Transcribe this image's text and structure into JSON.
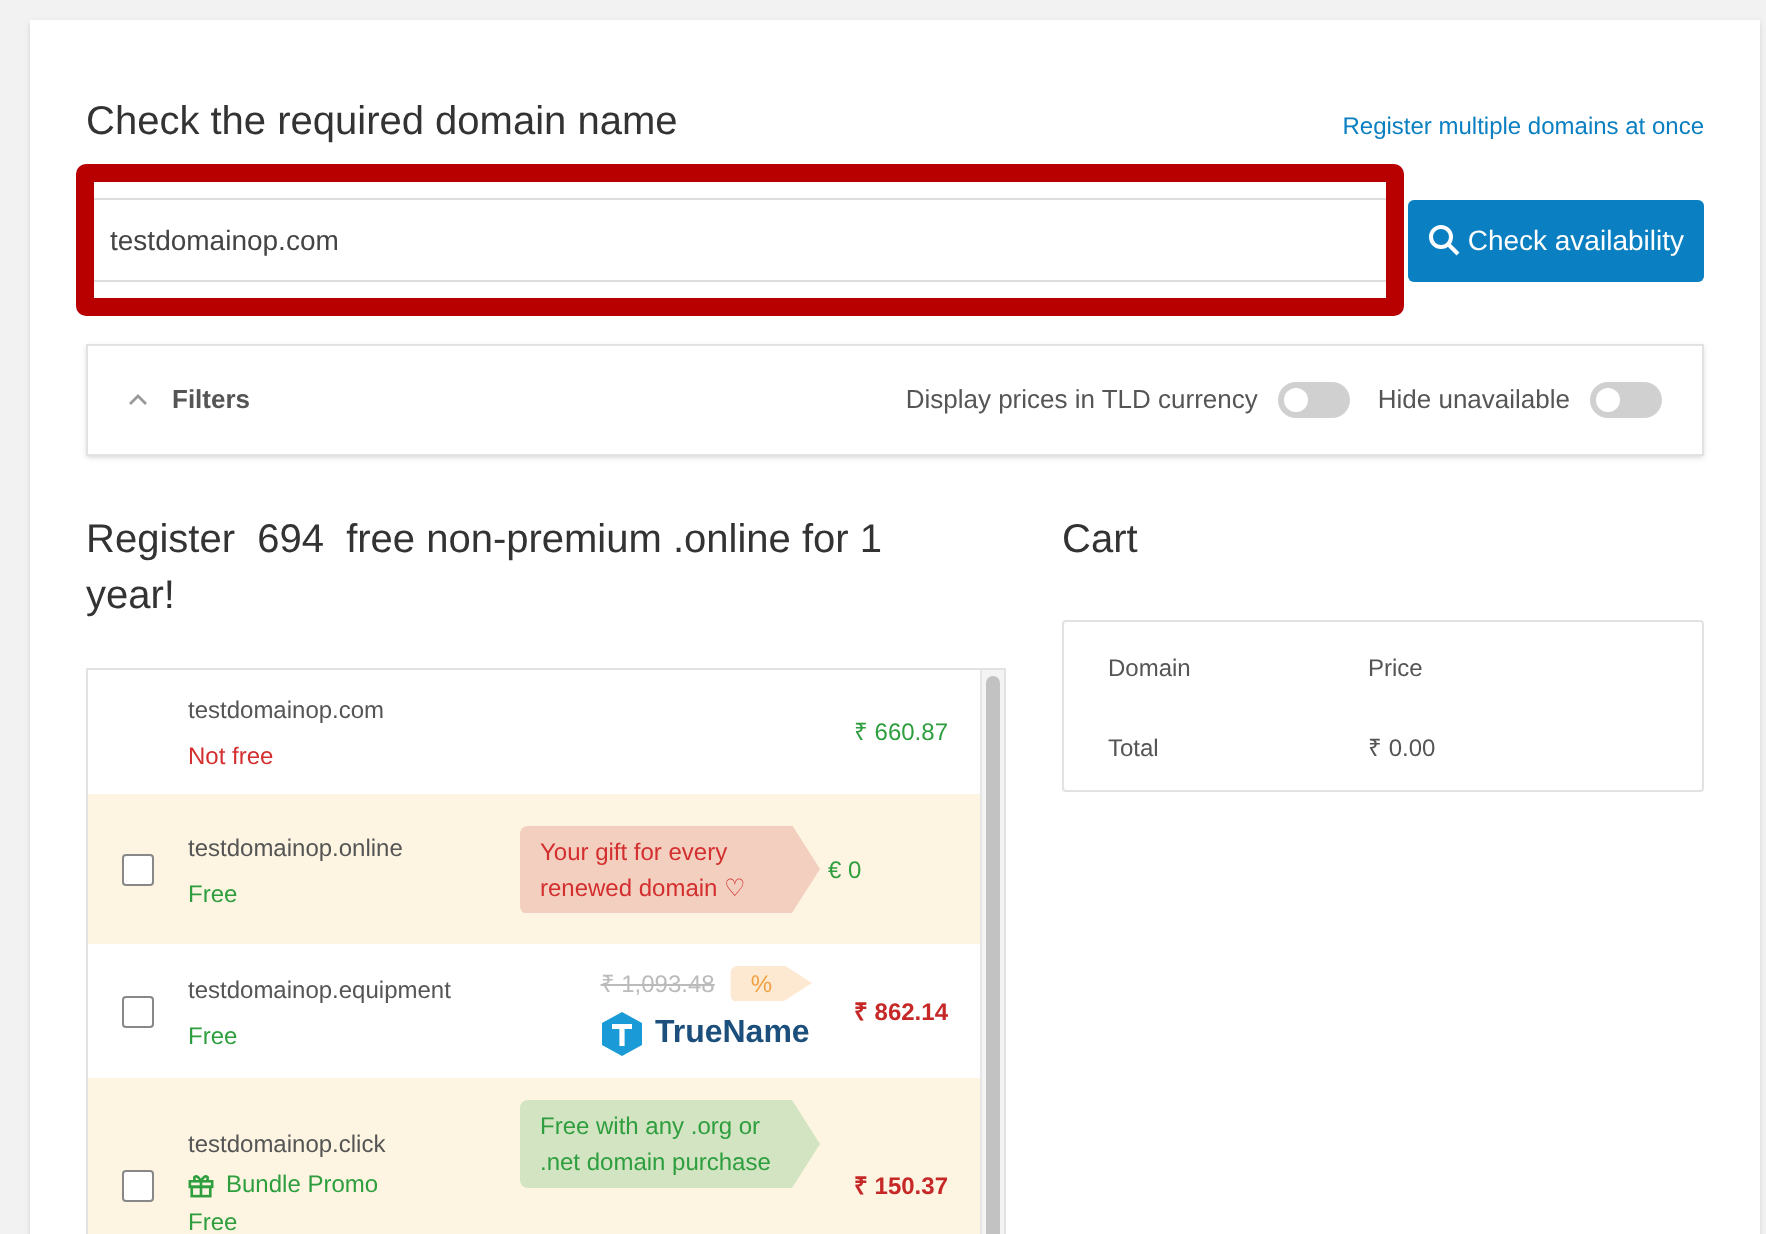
{
  "search": {
    "title": "Check the required domain name",
    "bulk_link": "Register multiple domains at once",
    "value": "testdomainop.com",
    "button": "Check availability",
    "highlighted": true
  },
  "filters": {
    "label": "Filters",
    "expanded": true,
    "toggles": [
      {
        "label": "Display prices in TLD currency",
        "on": false
      },
      {
        "label": "Hide unavailable",
        "on": false
      }
    ]
  },
  "offer": {
    "title": "Register  694  free non-premium .online for 1 year!"
  },
  "results": [
    {
      "kind": "taken",
      "domain": "testdomainop.com",
      "status": "Not free",
      "available": false,
      "price": "₹ 660.87",
      "promo_price": false,
      "highlighted": false
    },
    {
      "kind": "gift",
      "domain": "testdomainop.online",
      "status": "Free",
      "available": true,
      "checked": false,
      "highlighted": true,
      "tag": {
        "text": "Your gift for every renewed domain ♡",
        "color": "#f3cfc0"
      },
      "price": "€ 0",
      "promo_price": false
    },
    {
      "kind": "discount",
      "domain": "testdomainop.equipment",
      "status": "Free",
      "available": true,
      "checked": false,
      "highlighted": false,
      "old_price": "₹ 1,093.48",
      "discount": "%",
      "brand": "TrueName",
      "price": "₹ 862.14",
      "promo_price": true
    },
    {
      "kind": "bundle",
      "domain": "testdomainop.click",
      "bundle": "Bundle Promo",
      "status": "Free",
      "available": true,
      "checked": false,
      "highlighted": true,
      "tag": {
        "text": "Free with any .org or .net domain purchase",
        "color": "#d3e4c3"
      },
      "price": "₹ 150.37",
      "promo_price": true
    }
  ],
  "cart": {
    "title": "Cart",
    "columns": [
      "Domain",
      "Price"
    ],
    "total_label": "Total",
    "total": "₹ 0.00"
  }
}
